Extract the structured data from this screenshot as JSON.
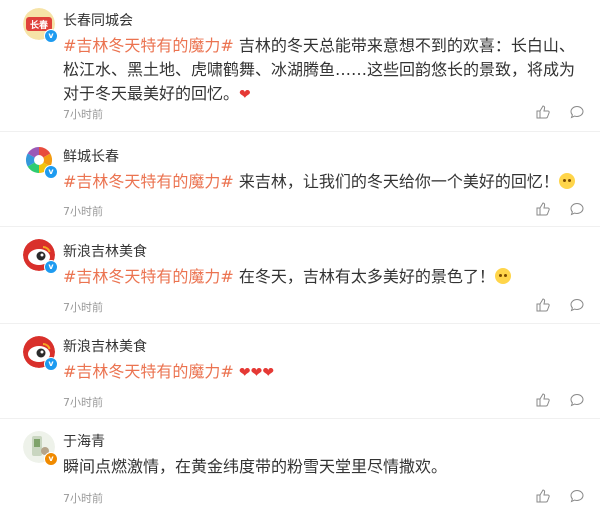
{
  "comments": [
    {
      "username": "长春同城会",
      "topic": "#吉林冬天特有的魔力#",
      "text": " 吉林的冬天总能带来意想不到的欢喜：长白山、松江水、黑土地、虎啸鹤舞、冰湖腾鱼……这些回韵悠长的景致，将成为对于冬天最美好的回忆。",
      "trailing": "❤",
      "time": "7小时前",
      "badge": "blue",
      "avatar_label": "长春"
    },
    {
      "username": "鲜城长春",
      "topic": "#吉林冬天特有的魔力#",
      "text": " 来吉林，让我们的冬天给你一个美好的回忆！",
      "trailing": "emoji",
      "time": "7小时前",
      "badge": "blue"
    },
    {
      "username": "新浪吉林美食",
      "topic": "#吉林冬天特有的魔力#",
      "text": " 在冬天，吉林有太多美好的景色了！",
      "trailing": "emoji",
      "time": "7小时前",
      "badge": "blue"
    },
    {
      "username": "新浪吉林美食",
      "topic": "#吉林冬天特有的魔力#",
      "text": " ",
      "trailing": "❤❤❤",
      "time": "7小时前",
      "badge": "blue"
    },
    {
      "username": "于海青",
      "topic": "",
      "text": "瞬间点燃激情，在黄金纬度带的粉雪天堂里尽情撒欢。",
      "trailing": "",
      "time": "7小时前",
      "badge": "orange"
    }
  ],
  "icons": {
    "like": "thumbs-up-icon",
    "reply": "comment-bubble-icon"
  },
  "colors": {
    "topic": "#eb7350",
    "time": "#999999",
    "text": "#333333",
    "verified_blue": "#1e9bf0",
    "verified_orange": "#f08a00"
  }
}
